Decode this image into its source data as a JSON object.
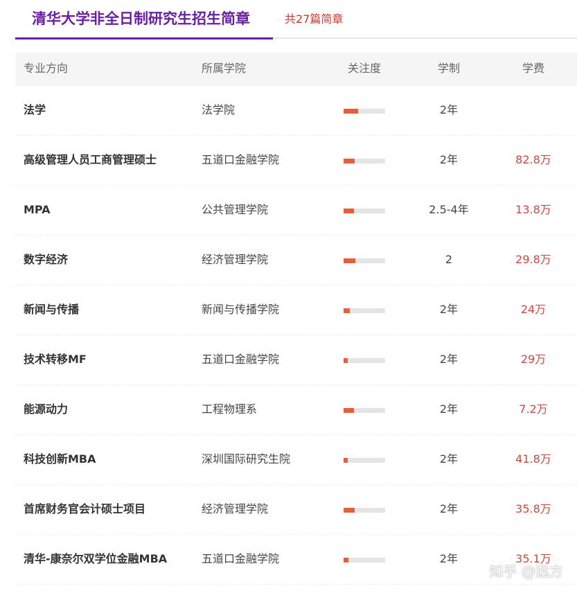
{
  "header": {
    "title": "清华大学非全日制研究生招生简章",
    "count_label": "共27篇简章"
  },
  "table": {
    "columns": [
      "专业方向",
      "所属学院",
      "关注度",
      "学制",
      "学费"
    ],
    "rows": [
      {
        "major": "法学",
        "college": "法学院",
        "attention": 0.35,
        "years": "2年",
        "fee": ""
      },
      {
        "major": "高级管理人员工商管理硕士",
        "college": "五道口金融学院",
        "attention": 0.27,
        "years": "2年",
        "fee": "82.8万"
      },
      {
        "major": "MPA",
        "college": "公共管理学院",
        "attention": 0.25,
        "years": "2.5-4年",
        "fee": "13.8万"
      },
      {
        "major": "数字经济",
        "college": "经济管理学院",
        "attention": 0.28,
        "years": "2",
        "fee": "29.8万"
      },
      {
        "major": "新闻与传播",
        "college": "新闻与传播学院",
        "attention": 0.15,
        "years": "2年",
        "fee": "24万"
      },
      {
        "major": "技术转移MF",
        "college": "五道口金融学院",
        "attention": 0.1,
        "years": "2年",
        "fee": "29万"
      },
      {
        "major": "能源动力",
        "college": "工程物理系",
        "attention": 0.25,
        "years": "2年",
        "fee": "7.2万"
      },
      {
        "major": "科技创新MBA",
        "college": "深圳国际研究生院",
        "attention": 0.1,
        "years": "2年",
        "fee": "41.8万"
      },
      {
        "major": "首席财务官会计硕士项目",
        "college": "经济管理学院",
        "attention": 0.27,
        "years": "2年",
        "fee": "35.8万"
      },
      {
        "major": "清华-康奈尔双学位金融MBA",
        "college": "五道口金融学院",
        "attention": 0.12,
        "years": "2年",
        "fee": "35.1万"
      }
    ]
  },
  "watermark": "知乎 @远方",
  "colors": {
    "accent": "#6a1fa0",
    "fee": "#d0473c",
    "bar_fill": "#e0603f",
    "bar_track": "#e5e5e5"
  }
}
